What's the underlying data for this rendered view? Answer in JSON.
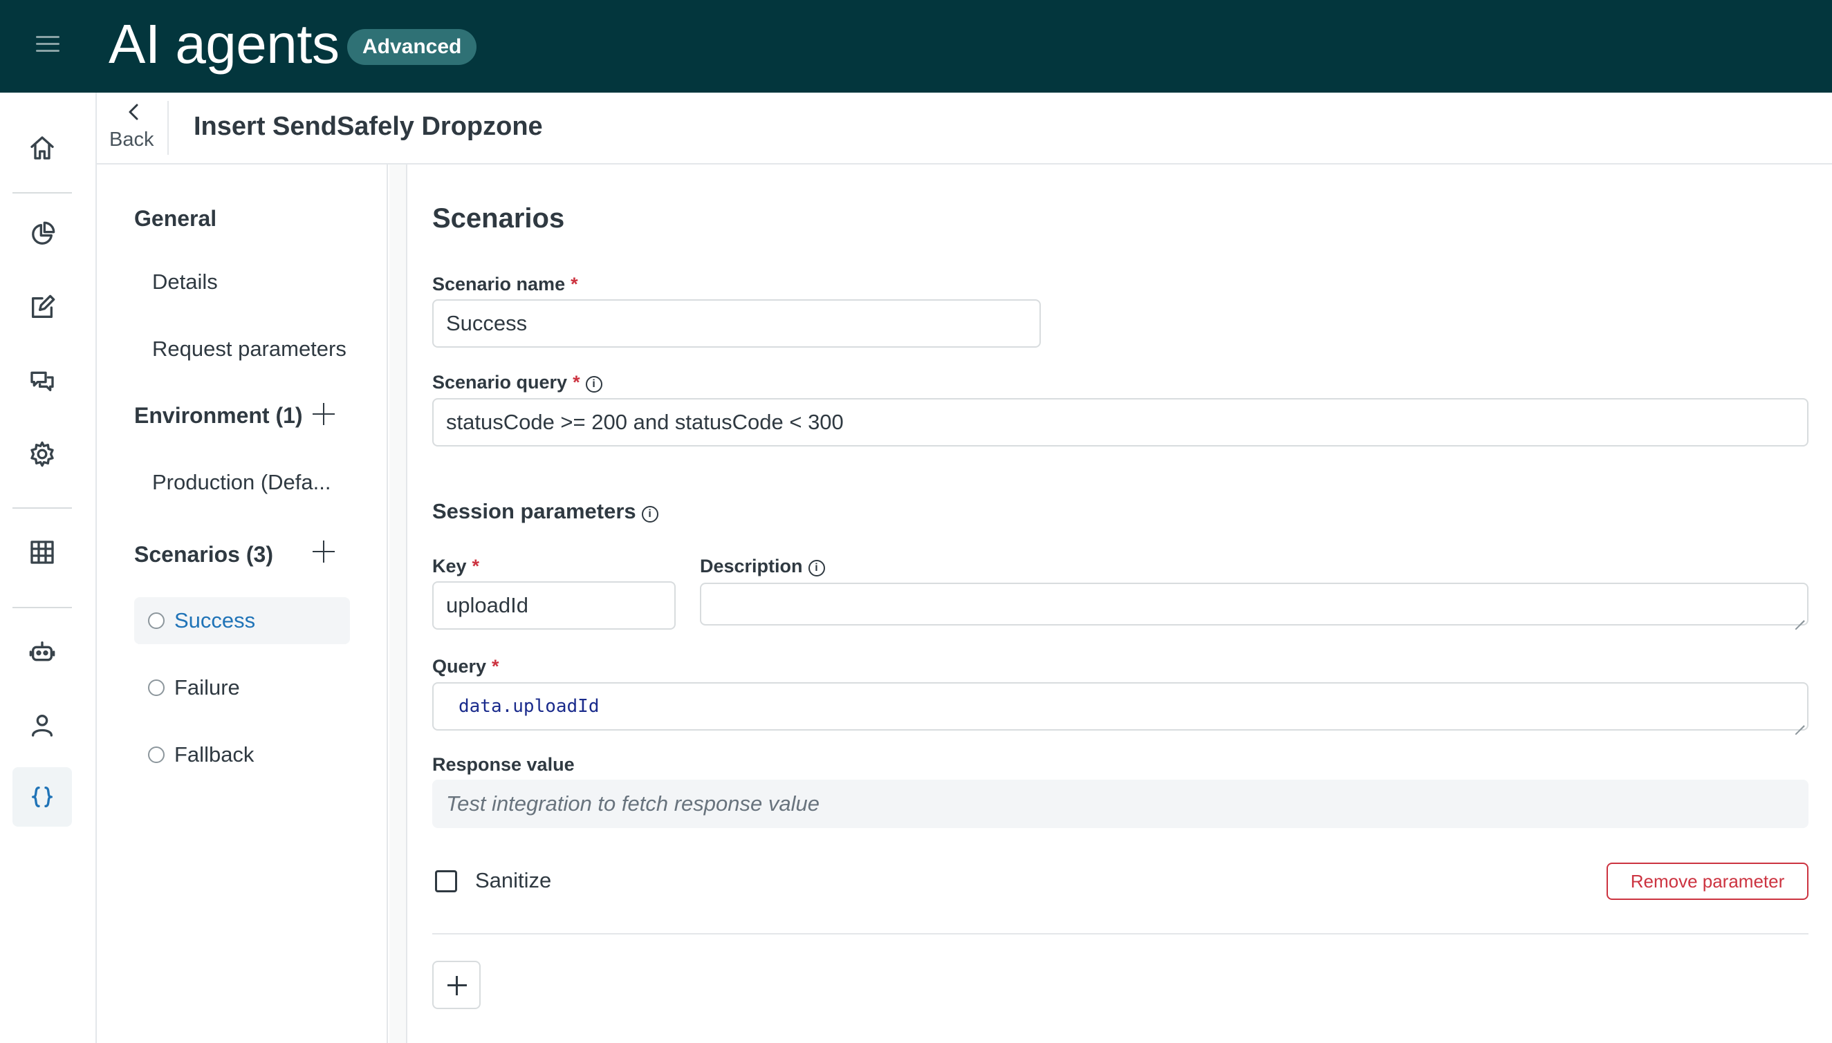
{
  "app": {
    "title": "AI agents",
    "badge": "Advanced"
  },
  "nav": {
    "icons": [
      "home-icon",
      "reports-icon",
      "edit-icon",
      "conversations-icon",
      "settings-icon",
      "table-icon",
      "bot-icon",
      "user-icon",
      "code-braces-icon"
    ],
    "active": "code-braces-icon"
  },
  "header": {
    "back_label": "Back",
    "title": "Insert SendSafely Dropzone"
  },
  "sidebar": {
    "general_heading": "General",
    "general_items": [
      "Details",
      "Request parameters"
    ],
    "environment_heading": "Environment (1)",
    "environment_items": [
      "Production (Defa..."
    ],
    "scenarios_heading": "Scenarios (3)",
    "scenarios": [
      {
        "label": "Success",
        "selected": true
      },
      {
        "label": "Failure",
        "selected": false
      },
      {
        "label": "Fallback",
        "selected": false
      }
    ]
  },
  "main": {
    "section_title": "Scenarios",
    "scenario_name_label": "Scenario name",
    "scenario_name_value": "Success",
    "scenario_query_label": "Scenario query",
    "scenario_query_value": "statusCode >= 200 and statusCode < 300",
    "session_params_title": "Session parameters",
    "key_label": "Key",
    "key_value": "uploadId",
    "description_label": "Description",
    "description_value": "",
    "query_label": "Query",
    "query_value": "data.uploadId",
    "response_label": "Response value",
    "response_placeholder": "Test integration to fetch response value",
    "sanitize_label": "Sanitize",
    "sanitize_checked": false,
    "remove_button": "Remove parameter",
    "required_mark": "*"
  },
  "colors": {
    "topbar": "#03363d",
    "badge": "#2f7175",
    "accent": "#1f73b7",
    "danger": "#cc3340"
  }
}
